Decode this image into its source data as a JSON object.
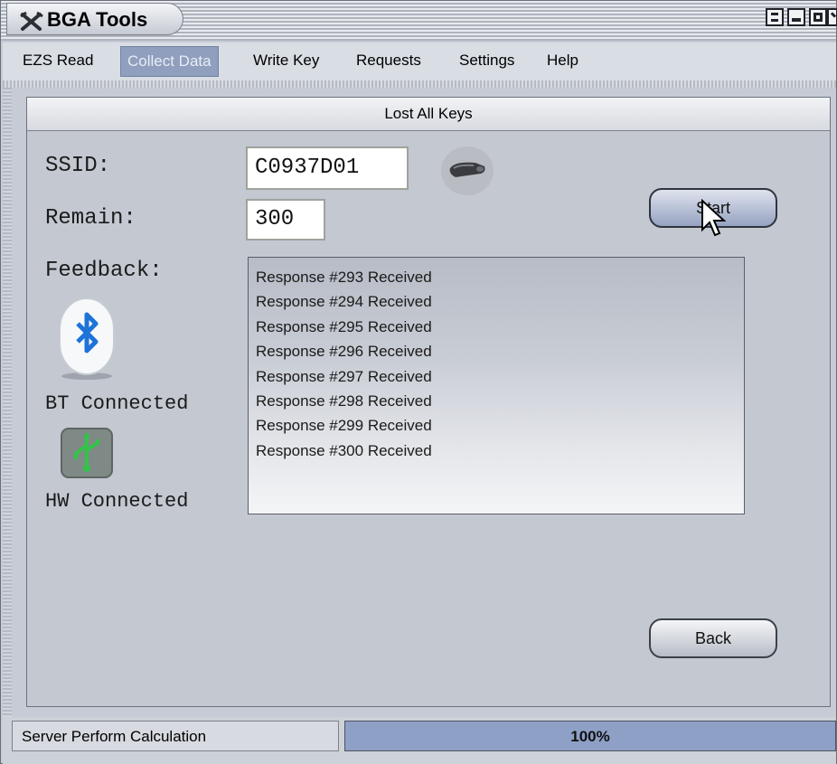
{
  "window": {
    "title": "BGA Tools"
  },
  "menu": {
    "items": [
      {
        "label": "EZS Read"
      },
      {
        "label": "Collect Data"
      },
      {
        "label": "Write Key"
      },
      {
        "label": "Requests"
      },
      {
        "label": "Settings"
      },
      {
        "label": "Help"
      }
    ],
    "selected": "Collect Data"
  },
  "panel": {
    "title": "Lost All Keys",
    "ssid_label": "SSID:",
    "ssid_value": "C0937D01",
    "remain_label": "Remain:",
    "remain_value": "300",
    "feedback_label": "Feedback:",
    "feedback_lines": [
      "Response #293 Received",
      "Response #294 Received",
      "Response #295 Received",
      "Response #296 Received",
      "Response #297 Received",
      "Response #298 Received",
      "Response #299 Received",
      "Response #300 Received"
    ],
    "bt_status": "BT Connected",
    "hw_status": "HW Connected",
    "start_label": "Start",
    "back_label": "Back"
  },
  "statusbar": {
    "text": "Server Perform Calculation",
    "progress_text": "100%",
    "progress_value": 1.0
  },
  "icons": {
    "app": "tools-icon",
    "key": "car-key-icon",
    "bluetooth": "bluetooth-icon",
    "usb": "usb-icon"
  },
  "colors": {
    "accent": "#8f9fbd",
    "bluetooth": "#1e73d8",
    "usb": "#33c24a"
  }
}
